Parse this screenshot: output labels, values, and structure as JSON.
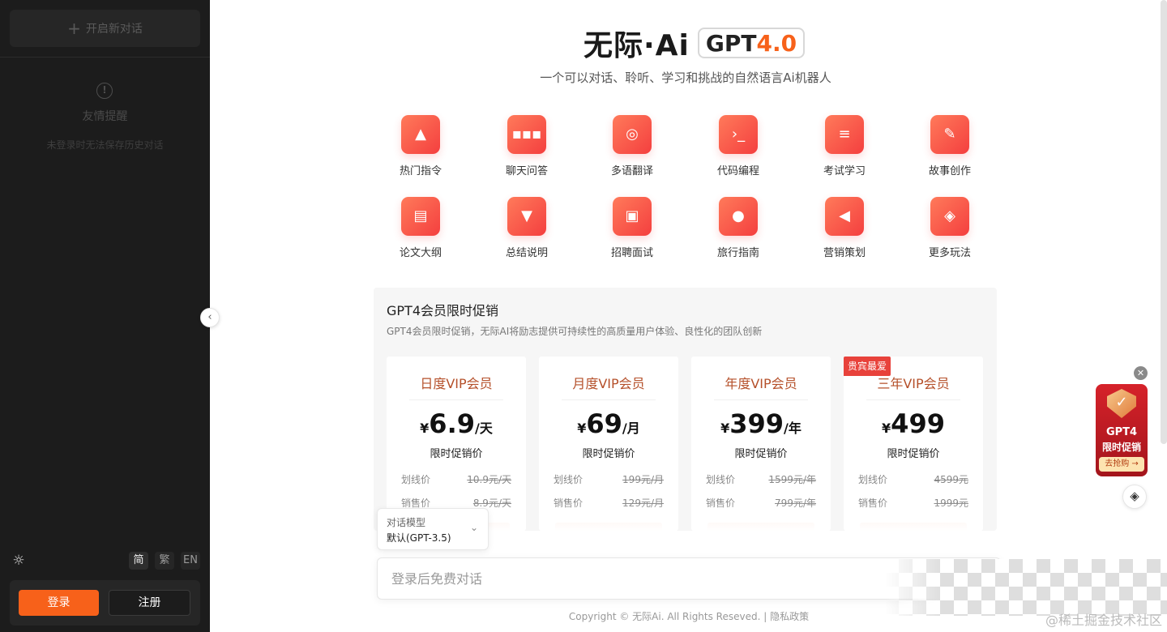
{
  "sidebar": {
    "new_chat_label": "开启新对话",
    "notice_title": "友情提醒",
    "notice_text": "未登录时无法保存历史对话",
    "languages": [
      "简",
      "繁",
      "EN"
    ],
    "login_label": "登录",
    "register_label": "注册"
  },
  "header": {
    "logo_text": "无际·Ai",
    "badge_prefix": "GPT",
    "badge_version": "4.0",
    "subtitle": "一个可以对话、聆听、学习和挑战的自然语言Ai机器人"
  },
  "features": [
    {
      "label": "热门指令",
      "icon": "fire-icon"
    },
    {
      "label": "聊天问答",
      "icon": "chat-icon"
    },
    {
      "label": "多语翻译",
      "icon": "globe-icon"
    },
    {
      "label": "代码编程",
      "icon": "terminal-icon"
    },
    {
      "label": "考试学习",
      "icon": "book-stack-icon"
    },
    {
      "label": "故事创作",
      "icon": "edit-icon"
    },
    {
      "label": "论文大纲",
      "icon": "document-icon"
    },
    {
      "label": "总结说明",
      "icon": "funnel-icon"
    },
    {
      "label": "招聘面试",
      "icon": "briefcase-icon"
    },
    {
      "label": "旅行指南",
      "icon": "location-pin-icon"
    },
    {
      "label": "营销策划",
      "icon": "megaphone-icon"
    },
    {
      "label": "更多玩法",
      "icon": "layers-icon"
    }
  ],
  "promo": {
    "title": "GPT4会员限时促销",
    "desc": "GPT4会员限时促销，无际AI将励志提供可持续性的高质量用户体验、良性化的团队创新",
    "hot_tag": "贵宾最爱",
    "plans": [
      {
        "name": "日度VIP会员",
        "currency": "¥",
        "price": "6.9",
        "unit": "/天",
        "price_label": "限时促销价",
        "list_key": "划线价",
        "list_val": "10.9元/天",
        "sale_key": "销售价",
        "sale_val": "8.9元/天"
      },
      {
        "name": "月度VIP会员",
        "currency": "¥",
        "price": "69",
        "unit": "/月",
        "price_label": "限时促销价",
        "list_key": "划线价",
        "list_val": "199元/月",
        "sale_key": "销售价",
        "sale_val": "129元/月"
      },
      {
        "name": "年度VIP会员",
        "currency": "¥",
        "price": "399",
        "unit": "/年",
        "price_label": "限时促销价",
        "list_key": "划线价",
        "list_val": "1599元/年",
        "sale_key": "销售价",
        "sale_val": "799元/年"
      },
      {
        "name": "三年VIP会员",
        "currency": "¥",
        "price": "499",
        "unit": "",
        "price_label": "限时促销价",
        "list_key": "划线价",
        "list_val": "4599元",
        "sale_key": "销售价",
        "sale_val": "1999元"
      }
    ]
  },
  "model_select": {
    "label": "对话模型",
    "value": "默认(GPT-3.5)"
  },
  "chat": {
    "placeholder": "登录后免费对话"
  },
  "footer": {
    "copyright": "Copyright © 无际Ai. All Rights Reseved. | ",
    "privacy": "隐私政策",
    "watermark": "@稀土掘金技术社区"
  },
  "side_promo": {
    "line1": "GPT4",
    "line2": "限时促销",
    "cta": "去抢购 →"
  },
  "colors": {
    "accent": "#f7611a",
    "sidebar_bg": "#1c1c1c",
    "icon_gradient_start": "#ff7a5a",
    "icon_gradient_end": "#f43f3f"
  }
}
